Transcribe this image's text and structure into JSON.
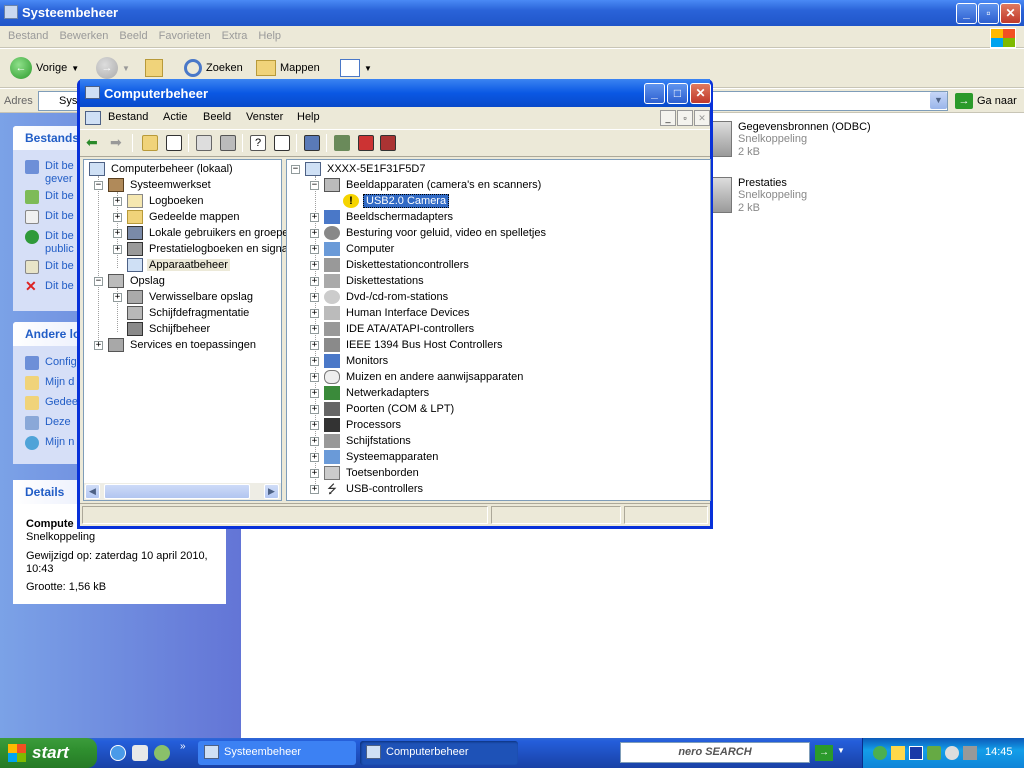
{
  "bg_window": {
    "title": "Systeembeheer",
    "menu": [
      "Bestand",
      "Bewerken",
      "Beeld",
      "Favorieten",
      "Extra",
      "Help"
    ],
    "toolbar": {
      "back": "Vorige",
      "search": "Zoeken",
      "folders": "Mappen"
    },
    "address": {
      "label": "Adres",
      "value": "Sys",
      "go": "Ga naar"
    },
    "file_tasks": {
      "header": "Bestands",
      "items": [
        "Dit be",
        "gever",
        "Dit be",
        "Dit be",
        "Dit be",
        "public",
        "Dit be",
        "Dit be"
      ]
    },
    "other_places": {
      "header": "Andere lo",
      "items": [
        "Config",
        "Mijn d",
        "Gedee",
        "Deze",
        "Mijn n"
      ]
    },
    "details": {
      "header": "Details",
      "name": "Compute",
      "type": "Snelkoppeling",
      "modified": "Gewijzigd op: zaterdag 10 april 2010,",
      "modified2": "10:43",
      "size": "Grootte: 1,56 kB"
    },
    "files": [
      {
        "name": "Gegevensbronnen (ODBC)",
        "type": "Snelkoppeling",
        "size": "2 kB"
      },
      {
        "name": "Prestaties",
        "type": "Snelkoppeling",
        "size": "2 kB"
      }
    ]
  },
  "fg_window": {
    "title": "Computerbeheer",
    "menu": [
      "Bestand",
      "Actie",
      "Beeld",
      "Venster",
      "Help"
    ],
    "left_tree": {
      "root": "Computerbeheer (lokaal)",
      "systeemwerkset": "Systeemwerkset",
      "sys_items": [
        "Logboeken",
        "Gedeelde mappen",
        "Lokale gebruikers en groepe",
        "Prestatielogboeken en signa",
        "Apparaatbeheer"
      ],
      "opslag": "Opslag",
      "opslag_items": [
        "Verwisselbare opslag",
        "Schijfdefragmentatie",
        "Schijfbeheer"
      ],
      "services": "Services en toepassingen"
    },
    "right_tree": {
      "root": "XXXX-5E1F31F5D7",
      "devices": [
        {
          "label": "Beeldapparaten (camera's en scanners)",
          "expanded": true
        },
        {
          "label": "Beeldschermadapters"
        },
        {
          "label": "Besturing voor geluid, video en spelletjes"
        },
        {
          "label": "Computer"
        },
        {
          "label": "Diskettestationcontrollers"
        },
        {
          "label": "Diskettestations"
        },
        {
          "label": "Dvd-/cd-rom-stations"
        },
        {
          "label": "Human Interface Devices"
        },
        {
          "label": "IDE ATA/ATAPI-controllers"
        },
        {
          "label": "IEEE 1394 Bus Host Controllers"
        },
        {
          "label": "Monitors"
        },
        {
          "label": "Muizen en andere aanwijsapparaten"
        },
        {
          "label": "Netwerkadapters"
        },
        {
          "label": "Poorten (COM & LPT)"
        },
        {
          "label": "Processors"
        },
        {
          "label": "Schijfstations"
        },
        {
          "label": "Systeemapparaten"
        },
        {
          "label": "Toetsenborden"
        },
        {
          "label": "USB-controllers"
        }
      ],
      "child": "USB2.0 Camera"
    }
  },
  "taskbar": {
    "start": "start",
    "tasks": [
      "Systeembeheer",
      "Computerbeheer"
    ],
    "search": "nero SEARCH",
    "clock": "14:45"
  }
}
